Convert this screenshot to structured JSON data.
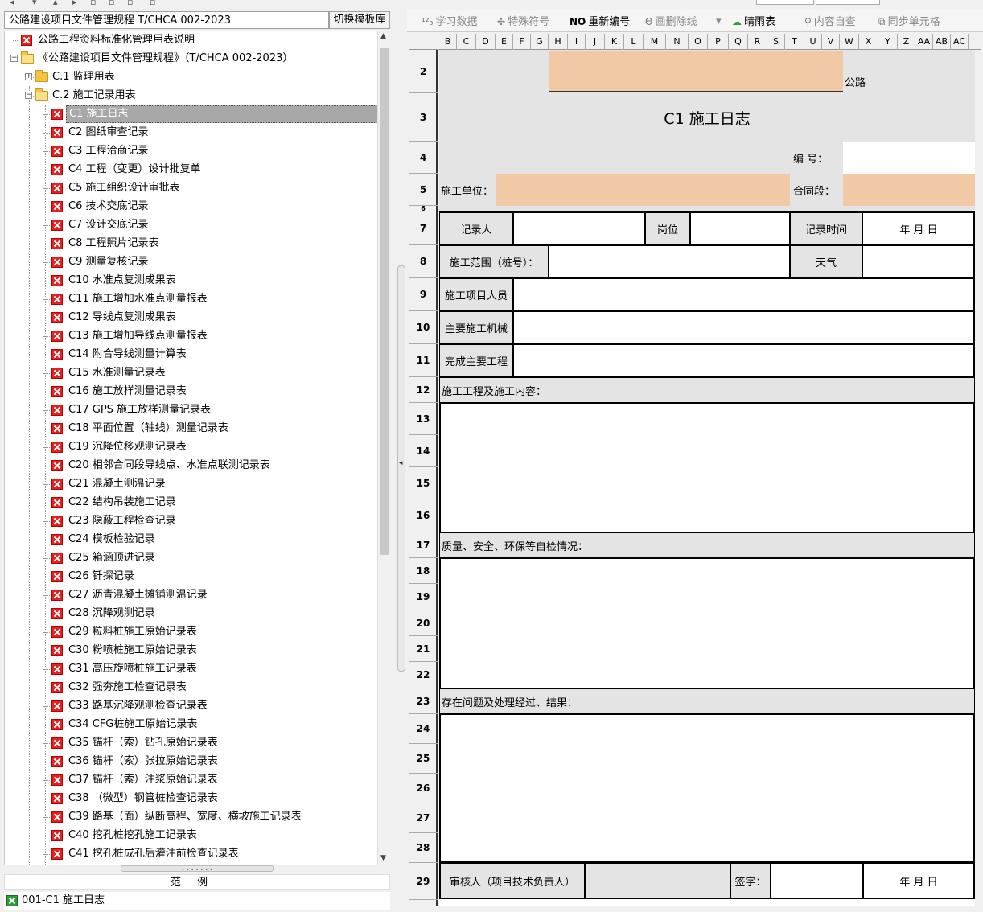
{
  "left": {
    "template_name": "公路建设项目文件管理规程 T/CHCA 002-2023",
    "switch_button": "切换模板库",
    "tree": [
      {
        "label": "公路工程资料标准化管理用表说明",
        "indent": 0,
        "icon": "x",
        "level": 1
      },
      {
        "label": "《公路建设项目文件管理规程》（T/CHCA 002-2023）",
        "icon": "folder-open",
        "level": 1,
        "expander": "−"
      },
      {
        "label": "C.1 监理用表",
        "icon": "folder",
        "level": 2,
        "expander": "+"
      },
      {
        "label": "C.2 施工记录用表",
        "icon": "folder-open",
        "level": 2,
        "expander": "−"
      },
      {
        "label": "C1 施工日志",
        "icon": "x",
        "level": 3,
        "selected": true
      },
      {
        "label": "C2 图纸审查记录",
        "icon": "x",
        "level": 3
      },
      {
        "label": "C3 工程洽商记录",
        "icon": "x",
        "level": 3
      },
      {
        "label": "C4 工程（变更）设计批复单",
        "icon": "x",
        "level": 3
      },
      {
        "label": "C5 施工组织设计审批表",
        "icon": "x",
        "level": 3
      },
      {
        "label": "C6 技术交底记录",
        "icon": "x",
        "level": 3
      },
      {
        "label": "C7 设计交底记录",
        "icon": "x",
        "level": 3
      },
      {
        "label": "C8 工程照片记录表",
        "icon": "x",
        "level": 3
      },
      {
        "label": "C9 测量复核记录",
        "icon": "x",
        "level": 3
      },
      {
        "label": "C10 水准点复测成果表",
        "icon": "x",
        "level": 3
      },
      {
        "label": "C11 施工增加水准点测量报表",
        "icon": "x",
        "level": 3
      },
      {
        "label": "C12 导线点复测成果表",
        "icon": "x",
        "level": 3
      },
      {
        "label": "C13 施工增加导线点测量报表",
        "icon": "x",
        "level": 3
      },
      {
        "label": "C14 附合导线测量计算表",
        "icon": "x",
        "level": 3
      },
      {
        "label": "C15 水准测量记录表",
        "icon": "x",
        "level": 3
      },
      {
        "label": "C16 施工放样测量记录表",
        "icon": "x",
        "level": 3
      },
      {
        "label": "C17 GPS 施工放样测量记录表",
        "icon": "x",
        "level": 3
      },
      {
        "label": "C18 平面位置（轴线）测量记录表",
        "icon": "x",
        "level": 3
      },
      {
        "label": "C19 沉降位移观测记录表",
        "icon": "x",
        "level": 3
      },
      {
        "label": "C20 相邻合同段导线点、水准点联测记录表",
        "icon": "x",
        "level": 3
      },
      {
        "label": "C21 混凝土测温记录",
        "icon": "x",
        "level": 3
      },
      {
        "label": "C22 结构吊装施工记录",
        "icon": "x",
        "level": 3
      },
      {
        "label": "C23 隐蔽工程检查记录",
        "icon": "x",
        "level": 3
      },
      {
        "label": "C24 模板检验记录",
        "icon": "x",
        "level": 3
      },
      {
        "label": "C25 箱涵顶进记录",
        "icon": "x",
        "level": 3
      },
      {
        "label": "C26 钎探记录",
        "icon": "x",
        "level": 3
      },
      {
        "label": "C27 沥青混凝土摊铺测温记录",
        "icon": "x",
        "level": 3
      },
      {
        "label": "C28 沉降观测记录",
        "icon": "x",
        "level": 3
      },
      {
        "label": "C29 粒料桩施工原始记录表",
        "icon": "x",
        "level": 3
      },
      {
        "label": "C30 粉喷桩施工原始记录表",
        "icon": "x",
        "level": 3
      },
      {
        "label": "C31 高压旋喷桩施工记录表",
        "icon": "x",
        "level": 3
      },
      {
        "label": "C32 强夯施工检查记录表",
        "icon": "x",
        "level": 3
      },
      {
        "label": "C33 路基沉降观测检查记录表",
        "icon": "x",
        "level": 3
      },
      {
        "label": "C34 CFG桩施工原始记录表",
        "icon": "x",
        "level": 3
      },
      {
        "label": "C35 锚杆（索）钻孔原始记录表",
        "icon": "x",
        "level": 3
      },
      {
        "label": "C36 锚杆（索）张拉原始记录表",
        "icon": "x",
        "level": 3
      },
      {
        "label": "C37 锚杆（索）注浆原始记录表",
        "icon": "x",
        "level": 3
      },
      {
        "label": "C38 （微型）钢管桩检查记录表",
        "icon": "x",
        "level": 3
      },
      {
        "label": "C39 路基（面）纵断高程、宽度、横坡施工记录表",
        "icon": "x",
        "level": 3
      },
      {
        "label": "C40 挖孔桩挖孔施工记录表",
        "icon": "x",
        "level": 3
      },
      {
        "label": "C41 挖孔桩成孔后灌注前检查记录表",
        "icon": "x",
        "level": 3
      }
    ],
    "legend_title": "范例",
    "legend_item": "001-C1 施工日志"
  },
  "toolbar": [
    {
      "label": "学习数据",
      "icon": "123-icon",
      "active": false
    },
    {
      "label": "特殊符号",
      "icon": "symbol-icon",
      "active": false
    },
    {
      "label": "重新编号",
      "icon": "no-icon",
      "active": true,
      "prefix": "NO"
    },
    {
      "label": "画删除线",
      "icon": "strike-icon",
      "active": false
    },
    {
      "label": "晴雨表",
      "icon": "weather-icon",
      "active": true
    },
    {
      "label": "内容自查",
      "icon": "check-icon",
      "active": false
    },
    {
      "label": "同步单元格",
      "icon": "sync-icon",
      "active": false
    }
  ],
  "columns": [
    "B",
    "C",
    "D",
    "E",
    "F",
    "G",
    "H",
    "I",
    "J",
    "K",
    "L",
    "M",
    "N",
    "O",
    "P",
    "Q",
    "R",
    "S",
    "T",
    "U",
    "V",
    "W",
    "X",
    "Y",
    "Z",
    "AA",
    "AB",
    "AC"
  ],
  "rows": [
    "2",
    "3",
    "4",
    "5",
    "6",
    "7",
    "8",
    "9",
    "10",
    "11",
    "12",
    "13",
    "14",
    "15",
    "16",
    "17",
    "18",
    "19",
    "20",
    "21",
    "22",
    "23",
    "24",
    "25",
    "26",
    "27",
    "28",
    "29"
  ],
  "form": {
    "road_suffix": "公路",
    "title": "C1  施工日志",
    "number_label": "编  号：",
    "unit_label": "施工单位：",
    "contract_label": "合同段：",
    "recorder_label": "记录人",
    "position_label": "岗位",
    "record_time_label": "记录时间",
    "date_placeholder": "年  月  日",
    "scope_label": "施工范围（桩号）：",
    "weather_label": "天气",
    "staff_label": "施工项目人员",
    "machinery_label": "主要施工机械",
    "completed_label": "完成主要工程",
    "content_label": "施工工程及施工内容：",
    "quality_label": "质量、安全、环保等自检情况：",
    "issues_label": "存在问题及处理经过、结果：",
    "reviewer_label": "审核人（项目技术负责人）",
    "sign_label": "签字：",
    "sign_date": "年  月  日"
  },
  "colors": {
    "peach": "#f2c9a5",
    "gray": "#e4e4e4",
    "selected": "#a8a8a8",
    "red_icon": "#e52020",
    "green_icon": "#2e9a3a"
  }
}
